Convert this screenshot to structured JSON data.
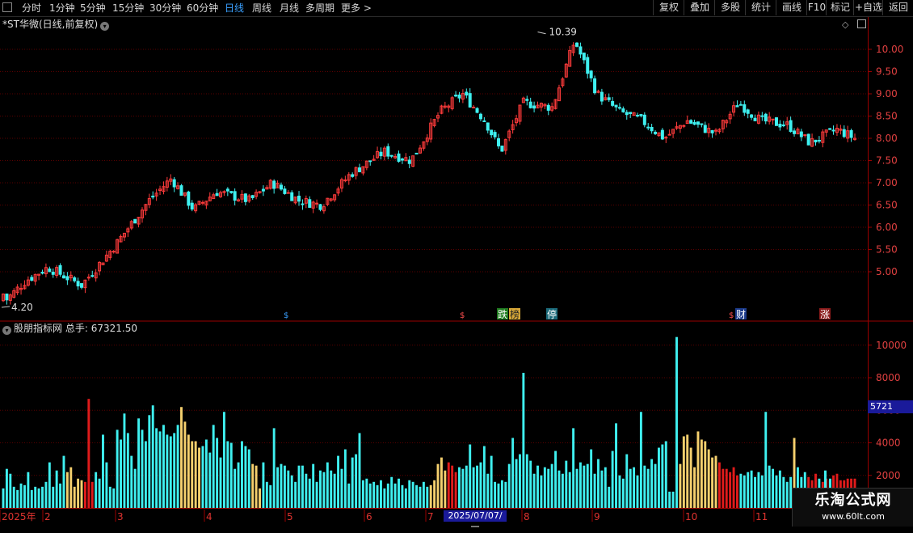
{
  "toolbar": {
    "periods": [
      {
        "label": "分时",
        "active": false
      },
      {
        "label": "1分钟",
        "active": false
      },
      {
        "label": "5分钟",
        "active": false
      },
      {
        "label": "15分钟",
        "active": false
      },
      {
        "label": "30分钟",
        "active": false
      },
      {
        "label": "60分钟",
        "active": false
      },
      {
        "label": "日线",
        "active": true
      },
      {
        "label": "周线",
        "active": false
      },
      {
        "label": "月线",
        "active": false
      },
      {
        "label": "多周期",
        "active": false
      },
      {
        "label": "更多 >",
        "active": false
      }
    ],
    "actions": [
      "复权",
      "叠加",
      "多股",
      "统计",
      "画线",
      "F10",
      "标记",
      "+自选",
      "返回"
    ]
  },
  "header": {
    "stock": "*ST华微",
    "mode": "(日线,前复权)"
  },
  "volume_header": {
    "indicator": "股朋指标网",
    "total_label": "总手:",
    "total_value": "67321.50"
  },
  "price_labels": {
    "high": "10.39",
    "low": "4.20"
  },
  "volume_current": "5721",
  "date_cursor": "2025/07/07/一",
  "date_axis": [
    {
      "label": "2025年",
      "color": "#e0332f"
    },
    {
      "label": "2",
      "color": "#e0332f"
    },
    {
      "label": "3",
      "color": "#e0332f"
    },
    {
      "label": "4",
      "color": "#e0332f"
    },
    {
      "label": "5",
      "color": "#e0332f"
    },
    {
      "label": "6",
      "color": "#e0332f"
    },
    {
      "label": "7",
      "color": "#e0332f"
    },
    {
      "label": "8",
      "color": "#e0332f"
    },
    {
      "label": "9",
      "color": "#e0332f"
    },
    {
      "label": "10",
      "color": "#e0332f"
    },
    {
      "label": "11",
      "color": "#e0332f"
    }
  ],
  "event_markers": [
    {
      "label": "跌",
      "bg": "#1f7a1f",
      "fg": "#fff"
    },
    {
      "label": "榜",
      "bg": "#d8a838",
      "fg": "#222"
    },
    {
      "label": "停",
      "bg": "#1b6a7a",
      "fg": "#fff"
    },
    {
      "label": "财",
      "bg": "#1b3a8a",
      "fg": "#fff"
    },
    {
      "label": "涨",
      "bg": "#8a1b1b",
      "fg": "#fff"
    }
  ],
  "watermark": {
    "title": "乐淘公式网",
    "url": "www.60lt.com"
  },
  "colors": {
    "up": "#ff3b3b",
    "down": "#3ff0f0",
    "grid": "#5a0000",
    "axis": "#9a0000",
    "vol_yellow": "#f5d06e",
    "vol_red": "#e01b1b",
    "label": "#e04040"
  },
  "chart_data": [
    {
      "type": "candlestick",
      "title": "*ST华微",
      "y_ticks": [
        5.0,
        5.5,
        6.0,
        6.5,
        7.0,
        7.5,
        8.0,
        8.5,
        9.0,
        9.5,
        10.0
      ],
      "ylim": [
        4.2,
        10.39
      ],
      "high": 10.39,
      "low": 4.2,
      "close_points": [
        [
          0,
          4.3
        ],
        [
          10,
          4.8
        ],
        [
          20,
          5.1
        ],
        [
          35,
          4.7
        ],
        [
          50,
          5.6
        ],
        [
          65,
          6.6
        ],
        [
          75,
          7.1
        ],
        [
          85,
          6.4
        ],
        [
          95,
          6.8
        ],
        [
          110,
          6.6
        ],
        [
          120,
          7.0
        ],
        [
          132,
          6.6
        ],
        [
          142,
          6.5
        ],
        [
          155,
          7.2
        ],
        [
          170,
          7.7
        ],
        [
          182,
          7.5
        ],
        [
          195,
          8.6
        ],
        [
          205,
          9.0
        ],
        [
          215,
          8.4
        ],
        [
          222,
          7.7
        ],
        [
          232,
          8.8
        ],
        [
          245,
          8.7
        ],
        [
          255,
          10.2
        ],
        [
          265,
          9.0
        ],
        [
          275,
          8.6
        ],
        [
          285,
          8.4
        ],
        [
          295,
          8.0
        ],
        [
          305,
          8.4
        ],
        [
          318,
          8.1
        ],
        [
          328,
          8.8
        ],
        [
          338,
          8.4
        ],
        [
          350,
          8.3
        ],
        [
          360,
          7.9
        ],
        [
          372,
          8.2
        ],
        [
          380,
          8.0
        ]
      ]
    },
    {
      "type": "bar",
      "title": "总手",
      "y_ticks": [
        2000,
        4000,
        6000,
        8000,
        10000
      ],
      "ylim": [
        0,
        11000
      ],
      "total": 67321.5,
      "current": 5721,
      "values": [
        1200,
        2400,
        2100,
        1300,
        1100,
        1500,
        1400,
        2200,
        1100,
        1300,
        1200,
        1300,
        1600,
        2800,
        1300,
        2300,
        1500,
        3200,
        2200,
        2500,
        1300,
        1800,
        1700,
        1600,
        6700,
        1600,
        2200,
        1800,
        4500,
        2800,
        1300,
        1200,
        4800,
        4200,
        5800,
        4600,
        3200,
        2400,
        5500,
        4800,
        4100,
        5700,
        6300,
        4900,
        4700,
        5100,
        4500,
        4400,
        4600,
        5100,
        6200,
        5300,
        4500,
        4100,
        4100,
        3700,
        3800,
        4200,
        3400,
        5100,
        4300,
        3100,
        5900,
        4100,
        4000,
        2400,
        2800,
        4100,
        3800,
        3600,
        2700,
        2600,
        1200,
        2800,
        1600,
        1400,
        4900,
        2500,
        2700,
        2600,
        2300,
        2000,
        1600,
        2600,
        2600,
        2100,
        1800,
        2700,
        1600,
        2300,
        2200,
        2800,
        2300,
        2100,
        3200,
        2400,
        3600,
        1500,
        3100,
        3300,
        4600,
        1700,
        1800,
        1500,
        1600,
        1400,
        1700,
        1200,
        1500,
        1900,
        1500,
        1800,
        1400,
        1200,
        1700,
        1600,
        1400,
        1300,
        1600,
        1300,
        1400,
        1700,
        2700,
        3100,
        2300,
        2800,
        2600,
        2200,
        2500,
        2400,
        2600,
        3900,
        2500,
        2600,
        2800,
        3800,
        2100,
        3200,
        1600,
        1500,
        1700,
        1600,
        2700,
        4300,
        3000,
        3300,
        8300,
        3300,
        2900,
        2100,
        2600,
        2000,
        2500,
        2400,
        2700,
        3500,
        2300,
        2100,
        2900,
        2200,
        4900,
        2400,
        2800,
        2600,
        2700,
        3600,
        2100,
        3000,
        2300,
        2500,
        1300,
        3500,
        5200,
        2000,
        1800,
        3300,
        2400,
        2500,
        2000,
        5900,
        2600,
        2400,
        3000,
        2700,
        3700,
        3900,
        4100,
        1000,
        1000,
        10500,
        2700,
        4400,
        4500,
        3700,
        2500,
        4700,
        4200,
        4100,
        3600,
        3100,
        3200,
        2800,
        2400,
        2400,
        2200,
        2500,
        2000,
        2100,
        2000,
        2200,
        2300,
        1900,
        2200,
        2000,
        5900,
        2600,
        2400,
        2000,
        2300,
        1900,
        1600,
        1900,
        4300,
        2500,
        1900,
        2200,
        1900,
        1700,
        2100,
        1800,
        1600,
        1800,
        1700,
        2000,
        2100,
        1700,
        1700,
        1800,
        1800,
        1800,
        1700,
        1500,
        2000,
        2200,
        2900,
        2200,
        2000,
        1900,
        2500,
        1700,
        2300,
        1900,
        1400,
        1900,
        1800,
        1900,
        2000,
        1800,
        1600,
        1500,
        1600,
        1500,
        2400,
        2000,
        1400,
        1500,
        1500,
        1300,
        1700,
        1500,
        1400,
        1600
      ],
      "extra": [
        {
          "x_index": "near_end",
          "values": [
            1000,
            2300,
            1800
          ]
        }
      ]
    }
  ]
}
